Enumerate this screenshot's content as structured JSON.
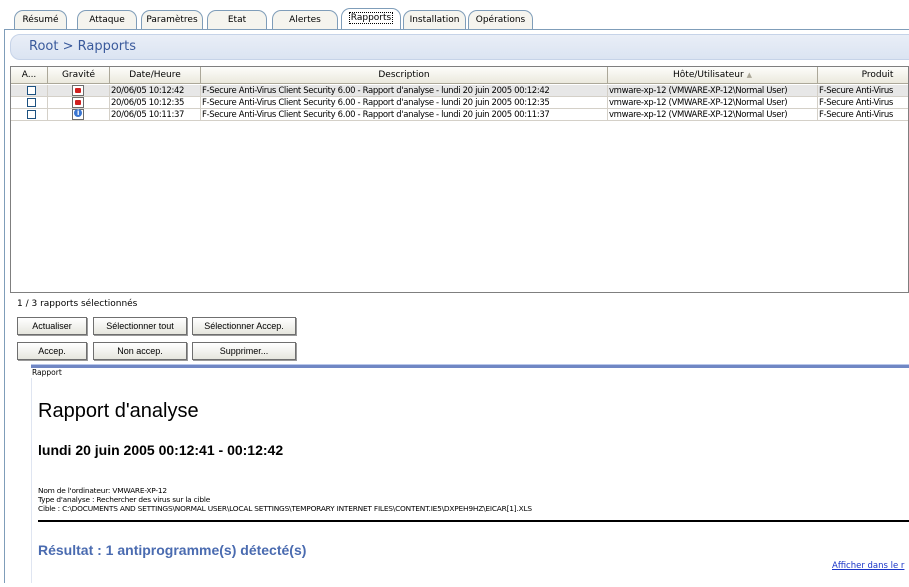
{
  "tabs": [
    {
      "label": "Résumé",
      "active": false
    },
    {
      "label": "Attaque",
      "active": false
    },
    {
      "label": "Paramètres",
      "active": false
    },
    {
      "label": "Etat",
      "active": false
    },
    {
      "label": "Alertes",
      "active": false
    },
    {
      "label": "Rapports",
      "active": true
    },
    {
      "label": "Installation",
      "active": false
    },
    {
      "label": "Opérations",
      "active": false
    }
  ],
  "breadcrumb": "Root > Rapports",
  "table": {
    "headers": [
      "A...",
      "Gravité",
      "Date/Heure",
      "Description",
      "Hôte/Utilisateur",
      "Produit"
    ],
    "sort_indicator": "▲",
    "rows": [
      {
        "severity": "alert-icon",
        "datetime": "20/06/05 10:12:42",
        "description": "F-Secure Anti-Virus Client Security 6.00  - Rapport d'analyse - lundi 20 juin 2005 00:12:42",
        "host": "vmware-xp-12 (VMWARE-XP-12\\Normal User)",
        "product": "F-Secure Anti-Virus"
      },
      {
        "severity": "alert-icon",
        "datetime": "20/06/05 10:12:35",
        "description": "F-Secure Anti-Virus Client Security 6.00  - Rapport d'analyse - lundi 20 juin 2005 00:12:35",
        "host": "vmware-xp-12 (VMWARE-XP-12\\Normal User)",
        "product": "F-Secure Anti-Virus"
      },
      {
        "severity": "info-icon",
        "datetime": "20/06/05 10:11:37",
        "description": "F-Secure Anti-Virus Client Security 6.00  - Rapport d'analyse - lundi 20 juin 2005 00:11:37",
        "host": "vmware-xp-12 (VMWARE-XP-12\\Normal User)",
        "product": "F-Secure Anti-Virus"
      }
    ]
  },
  "status": "1 / 3 rapports sélectionnés",
  "buttons": {
    "refresh": "Actualiser",
    "select_all": "Sélectionner tout",
    "select_accepted": "Sélectionner Accep.",
    "accept": "Accep.",
    "not_accept": "Non accep.",
    "delete": "Supprimer..."
  },
  "report": {
    "panel_label": "Rapport",
    "title": "Rapport d'analyse",
    "datetime": "lundi 20 juin 2005 00:12:41 - 00:12:42",
    "computer": "Nom de l'ordinateur: VMWARE-XP-12",
    "scan_type": "Type d'analyse : Rechercher des virus sur la cible",
    "target": "Cible : C:\\DOCUMENTS AND SETTINGS\\NORMAL USER\\LOCAL SETTINGS\\TEMPORARY INTERNET FILES\\CONTENT.IE5\\DXPEH9HZ\\EICAR[1].XLS",
    "result": "Résultat : 1 antiprogramme(s) détecté(s)",
    "link": "Afficher dans le r"
  }
}
